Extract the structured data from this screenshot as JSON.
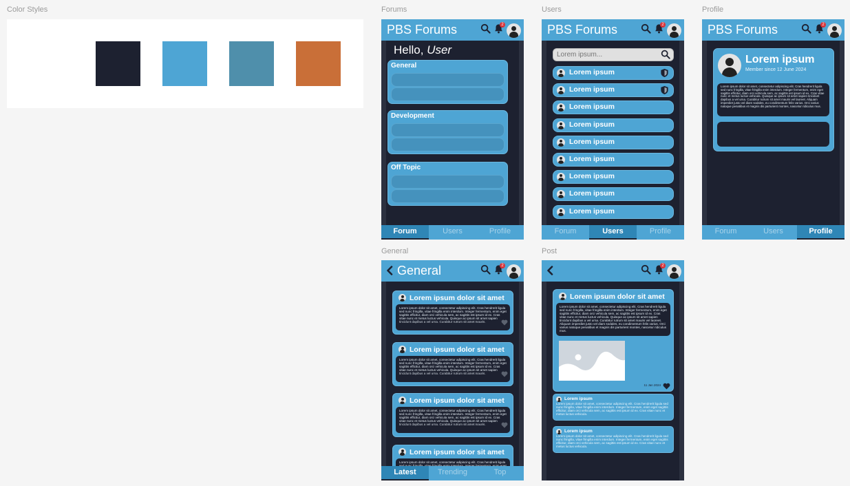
{
  "sections": {
    "color_styles": "Color Styles",
    "forums": "Forums",
    "users": "Users",
    "profile": "Profile",
    "general": "General",
    "post": "Post"
  },
  "colors": {
    "dark": "#1d2130",
    "primary": "#4ea5d4",
    "muted_blue": "#4f8fab",
    "orange": "#c96f38",
    "alert_red": "#d8343a"
  },
  "swatches": [
    "#1d2130",
    "#4ea5d4",
    "#4f8fab",
    "#c96f38"
  ],
  "app": {
    "brand": "PBS Forums",
    "notification_count": "2",
    "icons": [
      "search-icon",
      "bell-icon",
      "avatar-icon"
    ]
  },
  "forums_screen": {
    "greeting": "Hello,",
    "greeting_name": "User",
    "categories": [
      {
        "title": "General"
      },
      {
        "title": "Development"
      },
      {
        "title": "Off Topic"
      }
    ],
    "nav": [
      "Forum",
      "Users",
      "Profile"
    ]
  },
  "users_screen": {
    "search_placeholder": "Lorem ipsum...",
    "users": [
      {
        "name": "Lorem ipsum",
        "moderator": true
      },
      {
        "name": "Lorem ipsum",
        "moderator": true
      },
      {
        "name": "Lorem ipsum",
        "moderator": false
      },
      {
        "name": "Lorem ipsum",
        "moderator": false
      },
      {
        "name": "Lorem ipsum",
        "moderator": false
      },
      {
        "name": "Lorem ipsum",
        "moderator": false
      },
      {
        "name": "Lorem ipsum",
        "moderator": false
      },
      {
        "name": "Lorem ipsum",
        "moderator": false
      },
      {
        "name": "Lorem ipsum",
        "moderator": false
      }
    ],
    "nav": [
      "Forum",
      "Users",
      "Profile"
    ]
  },
  "profile_screen": {
    "name": "Lorem ipsum",
    "member_since": "Member since 12 June 2024",
    "bio": "Lorem ipsum dolor sit amet, consectetur adipiscing elit. Cras hendrerit ligula sed nunc fringilla, vitae fringilla enim interdum. Integer fermentum, enim eget sagittis efficitur, diam orci vehicula sem, ac sagittis est ipsum id ex. Cras vitae nunc et metus luctus vehicula. Quisque ac ipsum sit amet sapien tincidunt dapibus a vel urna. Curabitur rutrum sit amet mauris vel laoreet. Aliquam imperdiet justo vel diam sodales, eu condimentum felis varius. Orci varius natoque penatibus et magnis dis parturient montes, nascetur ridiculus mus.",
    "nav": [
      "Forum",
      "Users",
      "Profile"
    ]
  },
  "general_screen": {
    "title": "General",
    "post_title": "Lorem ipsum dolor sit amet",
    "post_body": "Lorem ipsum dolor sit amet, consectetur adipiscing elit. Cras hendrerit ligula sed nunc fringilla, vitae fringilla enim interdum. Integer fermentum, enim eget sagittis efficitur, diam orci vehicula sem, ac sagittis est ipsum id ex. Cras vitae nunc et metus luctus vehicula. Quisque ac ipsum sit amet sapien tincidunt dapibus a vel urna. Curabitur rutrum sit amet mauris.",
    "post_count": 4,
    "nav": [
      "Latest",
      "Trending",
      "Top"
    ]
  },
  "post_screen": {
    "title": "Lorem ipsum dolor sit amet",
    "body": "Lorem ipsum dolor sit amet, consectetur adipiscing elit. Cras hendrerit ligula sed nunc fringilla, vitae fringilla enim interdum. Integer fermentum, enim eget sagittis efficitur, diam orci vehicula sem, ac sagittis est ipsum id ex. Cras vitae nunc et metus luctus vehicula. Quisque ac ipsum sit amet sapien tincidunt dapibus a vel urna. Curabitur rutrum sit amet mauris vel laoreet. Aliquam imperdiet justo vel diam sodales, eu condimentum felis varius. Orci varius natoque penatibus et magnis dis parturient montes, nascetur ridiculus mus.",
    "date": "11 Jan 2024",
    "replies": [
      {
        "name": "Lorem ipsum",
        "text": "Lorem ipsum dolor sit amet, consectetur adipiscing elit. Cras hendrerit ligula sed nunc fringilla, vitae fringilla enim interdum. Integer fermentum, enim eget sagittis efficitur, diam orci vehicula sem, ac sagittis est ipsum id ex. Cras vitae nunc et metus luctus vehicula."
      },
      {
        "name": "Lorem ipsum",
        "text": "Lorem ipsum dolor sit amet, consectetur adipiscing elit. Cras hendrerit ligula sed nunc fringilla, vitae fringilla enim interdum. Integer fermentum, enim eget sagittis efficitur, diam orci vehicula sem, ac sagittis est ipsum id ex. Cras vitae nunc et metus luctus vehicula."
      }
    ]
  }
}
